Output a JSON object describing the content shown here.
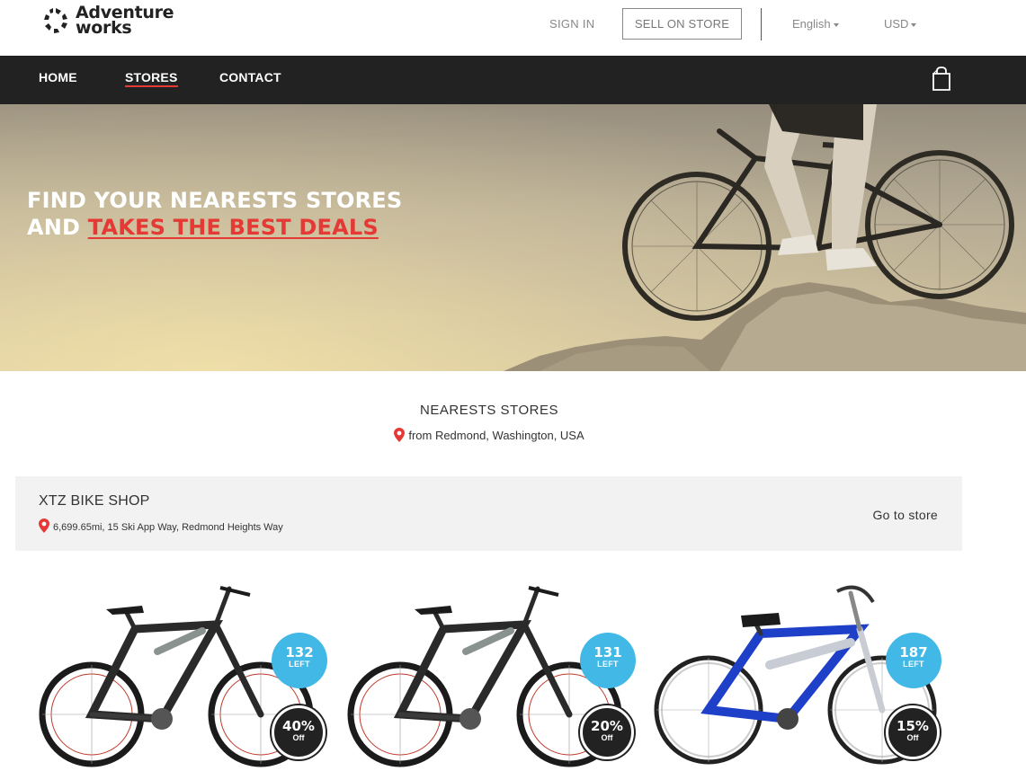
{
  "brand": {
    "name_line1": "Adventure",
    "name_line2": "works"
  },
  "header": {
    "sign_in": "SIGN IN",
    "sell_on_store": "SELL ON STORE",
    "language": "English",
    "currency": "USD"
  },
  "nav": {
    "items": [
      {
        "label": "HOME",
        "active": false
      },
      {
        "label": "STORES",
        "active": true
      },
      {
        "label": "CONTACT",
        "active": false
      }
    ],
    "cart_icon": "shopping-bag-icon"
  },
  "hero": {
    "line1": "FIND YOUR NEARESTS STORES",
    "line2_prefix": "AND ",
    "line2_accent": "TAKES THE BEST DEALS"
  },
  "nearest": {
    "title": "NEARESTS STORES",
    "location": "from Redmond, Washington, USA"
  },
  "store": {
    "name": "XTZ BIKE SHOP",
    "address": "6,699.65mi, 15 Ski App Way, Redmond Heights Way",
    "go_to_store": "Go to store"
  },
  "products": [
    {
      "left_count": "132",
      "left_label": "LEFT",
      "discount": "40%",
      "discount_label": "Off",
      "color": "black-grey"
    },
    {
      "left_count": "131",
      "left_label": "LEFT",
      "discount": "20%",
      "discount_label": "Off",
      "color": "black-grey"
    },
    {
      "left_count": "187",
      "left_label": "LEFT",
      "discount": "15%",
      "discount_label": "Off",
      "color": "blue-white"
    }
  ],
  "colors": {
    "accent_red": "#e53935",
    "nav_bg": "#222222",
    "badge_blue": "#42b8e6",
    "card_bg": "#f2f2f2"
  }
}
